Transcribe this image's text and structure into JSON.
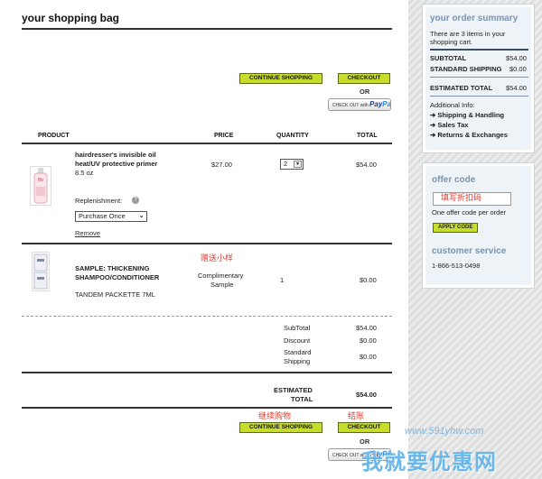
{
  "header": {
    "title": "your shopping bag"
  },
  "actions": {
    "continue_label": "CONTINUE SHOPPING",
    "checkout_label": "CHECKOUT",
    "or_label": "OR",
    "paypal_small": "CHECK OUT with",
    "paypal_logo_a": "Pay",
    "paypal_logo_b": "Pal"
  },
  "columns": {
    "product": "PRODUCT",
    "price": "PRICE",
    "quantity": "QUANTITY",
    "total": "TOTAL"
  },
  "items": [
    {
      "name_line1": "hairdresser's invisible oil",
      "name_line2": "heat/UV protective primer",
      "size": "8.5 oz",
      "price": "$27.00",
      "quantity": "2",
      "total": "$54.00",
      "replenishment_label": "Replenishment:",
      "help_icon": "?",
      "purchase_option": "Purchase Once",
      "remove_label": "Remove"
    },
    {
      "name_line1": "SAMPLE: THICKENING",
      "name_line2": "SHAMPOO/CONDITIONER",
      "subtitle": "TANDEM PACKETTE 7ML",
      "price_line1": "Complimentary",
      "price_line2": "Sample",
      "quantity": "1",
      "total": "$0.00"
    }
  ],
  "totals": {
    "subtotal_label": "SubTotal",
    "subtotal": "$54.00",
    "discount_label": "Discount",
    "discount": "$0.00",
    "shipping_label_1": "Standard",
    "shipping_label_2": "Shipping",
    "shipping": "$0.00",
    "estimated_label_1": "ESTIMATED",
    "estimated_label_2": "TOTAL",
    "estimated": "$54.00"
  },
  "annotations": {
    "free_sample": "赠送小样",
    "continue": "继续购物",
    "checkout": "结账"
  },
  "summary": {
    "title": "your order summary",
    "intro_1": "There are 3 items in your",
    "intro_2": "shopping cart.",
    "subtotal_label": "SUBTOTAL",
    "subtotal": "$54.00",
    "shipping_label": "STANDARD SHIPPING",
    "shipping": "$0.00",
    "estimated_label": "ESTIMATED TOTAL",
    "estimated": "$54.00",
    "info_label": "Additional Info:",
    "links": [
      "Shipping & Handling",
      "Sales Tax",
      "Returns & Exchanges"
    ]
  },
  "offer": {
    "title": "offer code",
    "input_value": "填写折扣码",
    "note": "One offer code per order",
    "apply_label": "APPLY CODE",
    "service_title": "customer service",
    "phone": "1-866-513-0498"
  },
  "watermark": {
    "url": "www.591yhw.com",
    "text": "我就要优惠网"
  },
  "colors": {
    "button": "#c8dc2c",
    "panel_title": "#7a93b0",
    "annotation": "#e23b2f"
  }
}
